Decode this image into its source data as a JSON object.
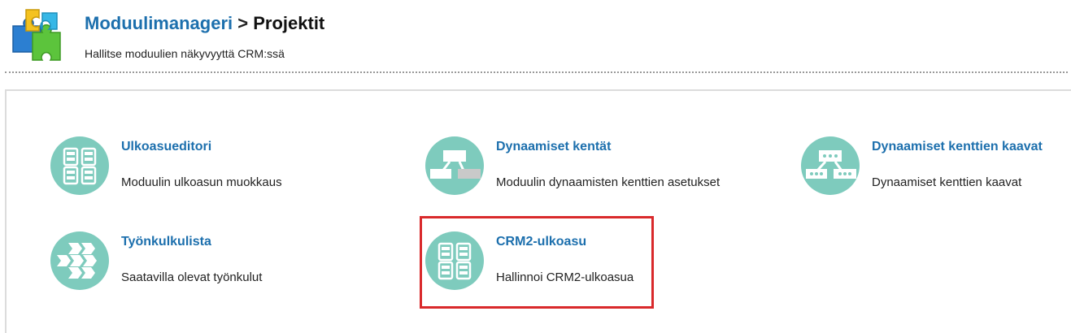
{
  "header": {
    "breadcrumb_link": "Moduulimanageri",
    "breadcrumb_separator": ">",
    "breadcrumb_current": "Projektit",
    "subtitle": "Hallitse moduulien näkyvyyttä CRM:ssä",
    "icon": "puzzle-icon"
  },
  "tiles": [
    {
      "title": "Ulkoasueditori",
      "description": "Moduulin ulkoasun muokkaus",
      "icon": "layout-grid-icon"
    },
    {
      "title": "Dynaamiset kentät",
      "description": "Moduulin dynaamisten kenttien asetukset",
      "icon": "dynamic-fields-icon"
    },
    {
      "title": "Dynaamiset kenttien kaavat",
      "description": "Dynaamiset kenttien kaavat",
      "icon": "formula-fields-icon"
    },
    {
      "title": "Työnkulkulista",
      "description": "Saatavilla olevat työnkulut",
      "icon": "workflow-arrows-icon"
    },
    {
      "title": "CRM2-ulkoasu",
      "description": "Hallinnoi CRM2-ulkoasua",
      "icon": "layout-grid-icon"
    }
  ],
  "colors": {
    "link": "#1c6fad",
    "tile_icon_bg": "#7ecbbd",
    "highlight": "#d9292b"
  }
}
